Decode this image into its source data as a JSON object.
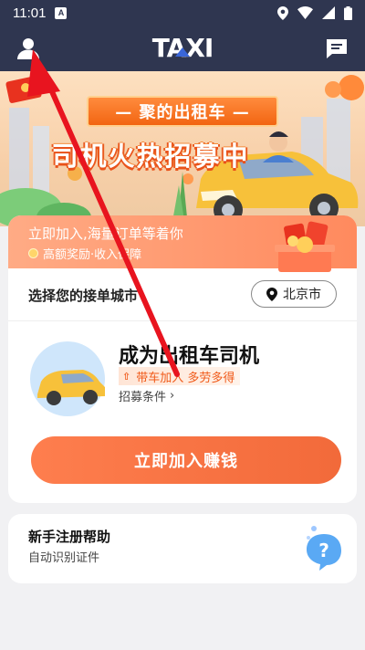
{
  "status_bar": {
    "time": "11:01",
    "notification_badge": "A",
    "icons": [
      "location-icon",
      "wifi-icon",
      "signal-icon",
      "battery-icon"
    ]
  },
  "header": {
    "logo_text": "TAXI",
    "left_icon": "user-icon",
    "right_icon": "message-icon"
  },
  "banner": {
    "ribbon_text": "— 聚的出租车 —",
    "title": "司机火热招募中"
  },
  "promo": {
    "headline": "立即加入,海量订单等着你",
    "subline": "高额奖励·收入保障"
  },
  "city": {
    "label": "选择您的接单城市",
    "selected_city": "北京市"
  },
  "driver": {
    "title": "成为出租车司机",
    "tag": "带车加入 多劳多得",
    "conditions_link": "招募条件",
    "conditions_chevron": "›"
  },
  "join_button": {
    "label": "立即加入赚钱"
  },
  "help": {
    "title": "新手注册帮助",
    "subtitle": "自动识别证件",
    "icon": "help-icon"
  },
  "colors": {
    "header_bg": "#2f3650",
    "accent_orange": "#f26a3a",
    "arrow_red": "#e8141f"
  }
}
